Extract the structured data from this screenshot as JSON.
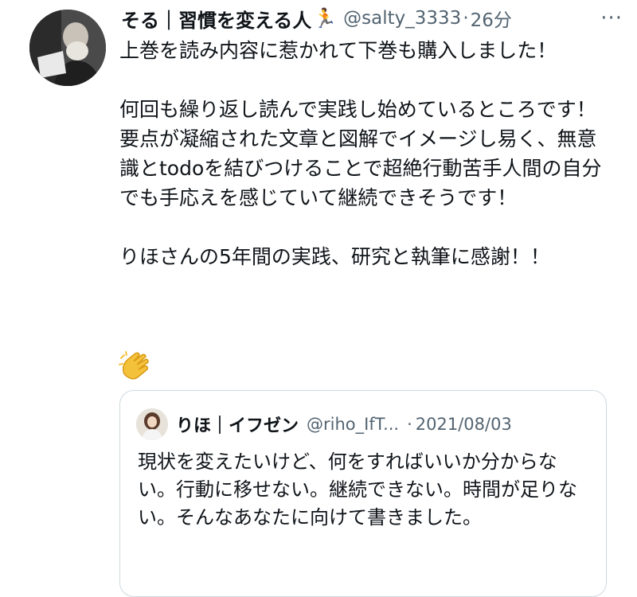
{
  "tweet": {
    "display_name": "そる｜習慣を変える人",
    "handle": "@salty_3333",
    "time": "26分",
    "more": "···",
    "body": "上巻を読み内容に惹かれて下巻も購入しました！\n\n何回も繰り返し読んで実践し始めているところです！\n要点が凝縮された文章と図解でイメージし易く、無意識とtodoを結びつけることで超絶行動苦手人間の自分でも手応えを感じていて継続できそうです！\n\nりほさんの5年間の実践、研究と執筆に感謝！！"
  },
  "quoted": {
    "display_name": "りほ｜イフゼン",
    "handle": "@riho_IfT...",
    "date": "2021/08/03",
    "body": "現状を変えたいけど、何をすればいいか分からない。行動に移せない。継続できない。時間が足りない。そんなあなたに向けて書きました。"
  },
  "icons": {
    "runner": "runner-emoji",
    "clap": "clapping-hands-emoji",
    "more": "more-icon"
  },
  "colors": {
    "text": "#0f1419",
    "secondary": "#536471",
    "border": "#cfd9de"
  }
}
